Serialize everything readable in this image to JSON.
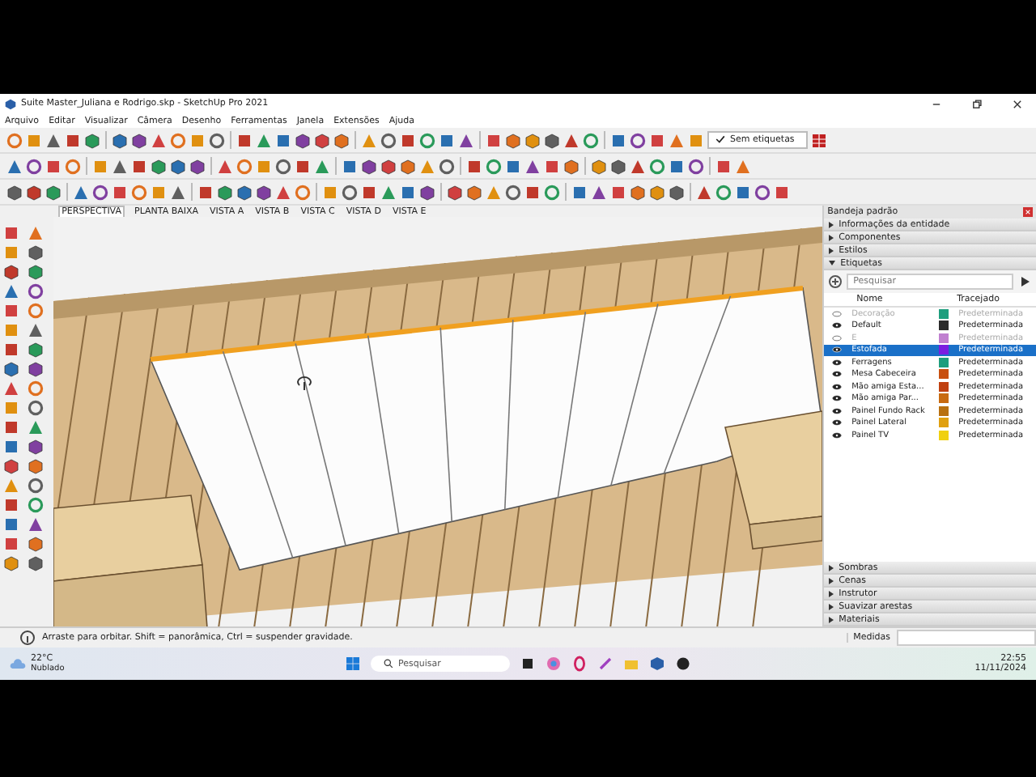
{
  "window": {
    "title": "Suite Master_Juliana e Rodrigo.skp - SketchUp Pro 2021"
  },
  "menu": [
    "Arquivo",
    "Editar",
    "Visualizar",
    "Câmera",
    "Desenho",
    "Ferramentas",
    "Janela",
    "Extensões",
    "Ajuda"
  ],
  "tag_dropdown": {
    "value": "Sem etiquetas"
  },
  "scene_tabs": [
    {
      "label": "PERSPECTIVA",
      "selected": true
    },
    {
      "label": "PLANTA BAIXA",
      "selected": false
    },
    {
      "label": "VISTA A",
      "selected": false
    },
    {
      "label": "VISTA B",
      "selected": false
    },
    {
      "label": "VISTA C",
      "selected": false
    },
    {
      "label": "VISTA D",
      "selected": false
    },
    {
      "label": "VISTA E",
      "selected": false
    }
  ],
  "tray": {
    "title": "Bandeja padrão",
    "sections_top": [
      {
        "label": "Informações da entidade",
        "expanded": false
      },
      {
        "label": "Componentes",
        "expanded": false
      },
      {
        "label": "Estilos",
        "expanded": false
      },
      {
        "label": "Etiquetas",
        "expanded": true
      }
    ],
    "search": {
      "placeholder": "Pesquisar"
    },
    "columns": [
      "Nome",
      "Tracejado"
    ],
    "tags": [
      {
        "name": "Decoração",
        "visible": false,
        "color": "#1e9e7e",
        "dash": "Predeterminada",
        "selected": false
      },
      {
        "name": "Default",
        "visible": true,
        "color": "#2a2a2a",
        "dash": "Predeterminada",
        "selected": false
      },
      {
        "name": "E",
        "visible": false,
        "color": "#c080d0",
        "dash": "Predeterminada",
        "selected": false
      },
      {
        "name": "Estofada",
        "visible": true,
        "color": "#7a1ee0",
        "dash": "Predeterminada",
        "selected": true
      },
      {
        "name": "Ferragens",
        "visible": true,
        "color": "#1e9e7e",
        "dash": "Predeterminada",
        "selected": false
      },
      {
        "name": "Mesa Cabeceira",
        "visible": true,
        "color": "#c85010",
        "dash": "Predeterminada",
        "selected": false
      },
      {
        "name": "Mão amiga Esta...",
        "visible": true,
        "color": "#c04010",
        "dash": "Predeterminada",
        "selected": false
      },
      {
        "name": "Mão amiga Par...",
        "visible": true,
        "color": "#c86a10",
        "dash": "Predeterminada",
        "selected": false
      },
      {
        "name": "Painel Fundo Rack",
        "visible": true,
        "color": "#b87010",
        "dash": "Predeterminada",
        "selected": false
      },
      {
        "name": "Painel Lateral",
        "visible": true,
        "color": "#e0a010",
        "dash": "Predeterminada",
        "selected": false
      },
      {
        "name": "Painel TV",
        "visible": true,
        "color": "#f0d010",
        "dash": "Predeterminada",
        "selected": false
      }
    ],
    "sections_bottom": [
      {
        "label": "Sombras",
        "expanded": false
      },
      {
        "label": "Cenas",
        "expanded": false
      },
      {
        "label": "Instrutor",
        "expanded": false
      },
      {
        "label": "Suavizar arestas",
        "expanded": false
      },
      {
        "label": "Materiais",
        "expanded": false
      }
    ]
  },
  "status_bar": {
    "message": "Arraste para orbitar. Shift = panorâmica, Ctrl = suspender gravidade.",
    "measurements_label": "Medidas"
  },
  "taskbar": {
    "temperature": "22°C",
    "weather": "Nublado",
    "search_placeholder": "Pesquisar",
    "time": "22:55",
    "date": "11/11/2024"
  }
}
